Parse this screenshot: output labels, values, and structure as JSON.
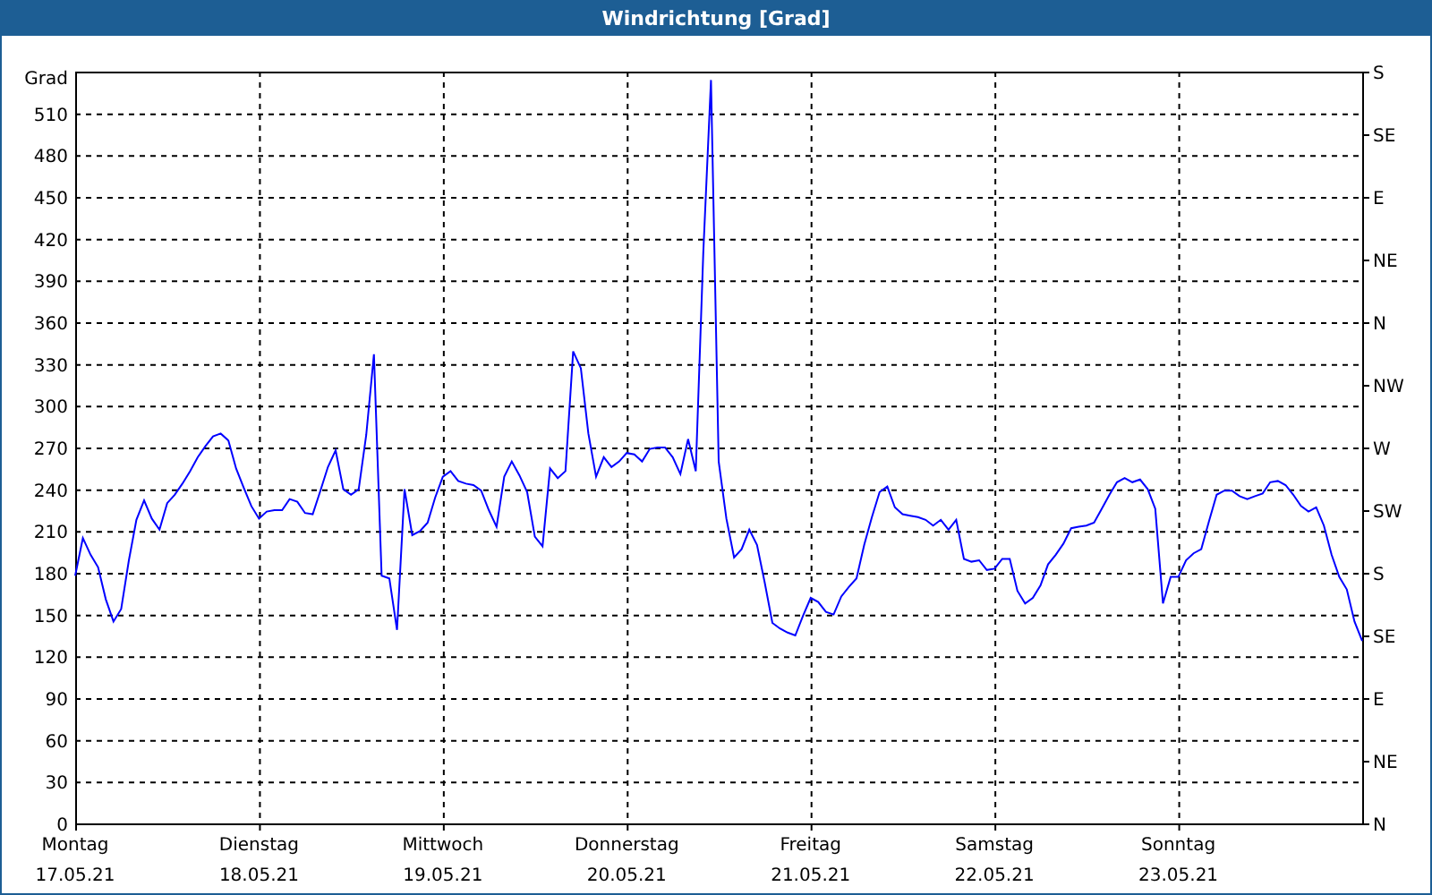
{
  "window": {
    "title": "Windrichtung [Grad]"
  },
  "chart": {
    "compass_labels": [
      "S",
      "SE",
      "E",
      "NE",
      "N",
      "NW",
      "W",
      "SW",
      "S",
      "SE",
      "E",
      "NE",
      "N"
    ],
    "chart_data": {
      "type": "line",
      "grid": true,
      "ylabel": "Grad",
      "ylim": [
        0,
        540
      ],
      "yticks": [
        0,
        30,
        60,
        90,
        120,
        150,
        180,
        210,
        240,
        270,
        300,
        330,
        360,
        390,
        420,
        450,
        480,
        510
      ],
      "categories": [
        "Montag\n17.05.21",
        null,
        null,
        null,
        null,
        null,
        null,
        null,
        null,
        null,
        null,
        null,
        null,
        null,
        null,
        null,
        null,
        null,
        null,
        null,
        null,
        null,
        null,
        null,
        "Dienstag\n18.05.21",
        null,
        null,
        null,
        null,
        null,
        null,
        null,
        null,
        null,
        null,
        null,
        null,
        null,
        null,
        null,
        null,
        null,
        null,
        null,
        null,
        null,
        null,
        null,
        "Mittwoch\n19.05.21",
        null,
        null,
        null,
        null,
        null,
        null,
        null,
        null,
        null,
        null,
        null,
        null,
        null,
        null,
        null,
        null,
        null,
        null,
        null,
        null,
        null,
        null,
        null,
        "Donnerstag\n20.05.21",
        null,
        null,
        null,
        null,
        null,
        null,
        null,
        null,
        null,
        null,
        null,
        null,
        null,
        null,
        null,
        null,
        null,
        null,
        null,
        null,
        null,
        null,
        null,
        "Freitag\n21.05.21",
        null,
        null,
        null,
        null,
        null,
        null,
        null,
        null,
        null,
        null,
        null,
        null,
        null,
        null,
        null,
        null,
        null,
        null,
        null,
        null,
        null,
        null,
        null,
        "Samstag\n22.05.21",
        null,
        null,
        null,
        null,
        null,
        null,
        null,
        null,
        null,
        null,
        null,
        null,
        null,
        null,
        null,
        null,
        null,
        null,
        null,
        null,
        null,
        null,
        null,
        "Sonntag\n23.05.21",
        null,
        null,
        null,
        null,
        null,
        null,
        null,
        null,
        null,
        null,
        null,
        null,
        null,
        null,
        null,
        null,
        null,
        null,
        null,
        null,
        null,
        null,
        null,
        null
      ],
      "series": [
        {
          "color": "#0000ff",
          "values": [
            178,
            205,
            193,
            184,
            161,
            145,
            154,
            189,
            218,
            232,
            219,
            211,
            230,
            236,
            244,
            253,
            263,
            271,
            278,
            280,
            275,
            255,
            241,
            228,
            219,
            224,
            225,
            225,
            233,
            231,
            223,
            222,
            239,
            256,
            268,
            240,
            236,
            240,
            279,
            337,
            178,
            176,
            139,
            240,
            207,
            210,
            216,
            234,
            249,
            253,
            246,
            244,
            243,
            239,
            225,
            213,
            249,
            260,
            250,
            238,
            206,
            199,
            255,
            248,
            253,
            339,
            327,
            280,
            249,
            263,
            256,
            260,
            266,
            265,
            260,
            269,
            270,
            270,
            263,
            251,
            276,
            253,
            410,
            534,
            260,
            219,
            191,
            197,
            211,
            200,
            173,
            144,
            140,
            137,
            135,
            149,
            162,
            159,
            152,
            150,
            163,
            170,
            176,
            200,
            220,
            238,
            242,
            227,
            222,
            221,
            220,
            218,
            214,
            218,
            211,
            218,
            190,
            188,
            189,
            182,
            183,
            190,
            190,
            167,
            158,
            162,
            171,
            186,
            193,
            201,
            212,
            213,
            214,
            216,
            226,
            236,
            245,
            248,
            245,
            247,
            240,
            226,
            158,
            177,
            177,
            189,
            194,
            197,
            217,
            236,
            239,
            239,
            235,
            233,
            235,
            237,
            245,
            246,
            243,
            236,
            228,
            224,
            227,
            214,
            193,
            177,
            168,
            145,
            131
          ]
        }
      ]
    }
  }
}
